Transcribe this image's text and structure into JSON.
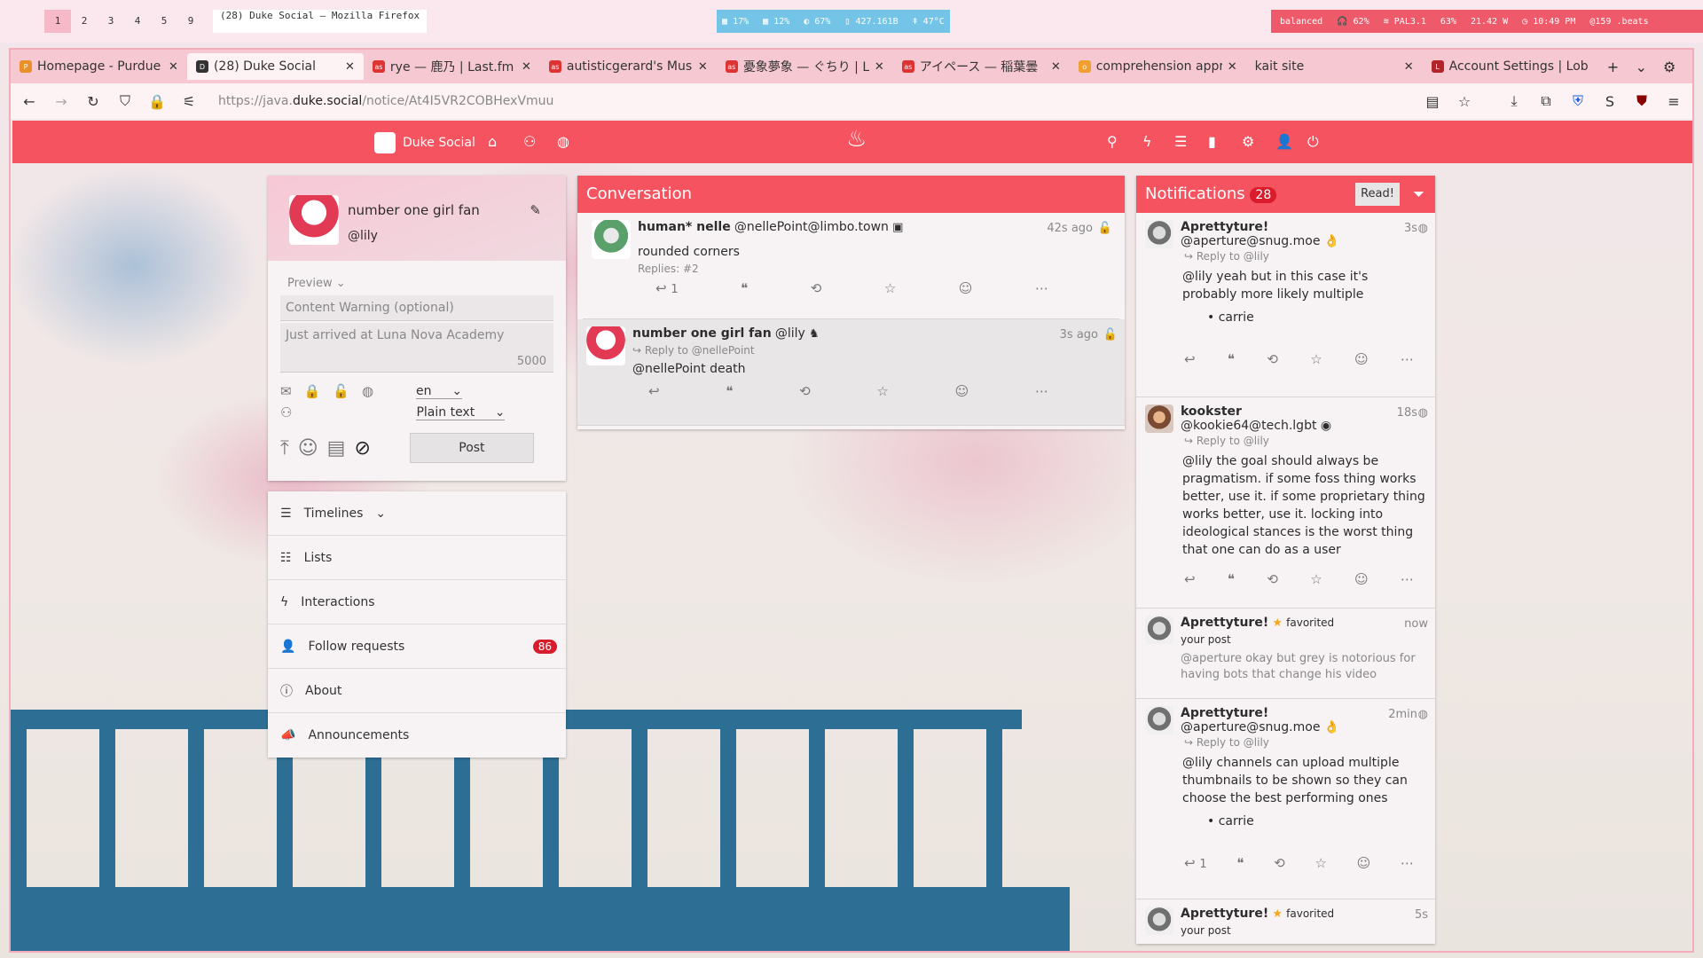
{
  "sysbar": {
    "workspaces": [
      "1",
      "2",
      "3",
      "4",
      "5",
      "9"
    ],
    "window_title": "(28) Duke Social — Mozilla Firefox",
    "stats": [
      "17%",
      "12%",
      "67%",
      "427.161B",
      "47°C"
    ],
    "right": [
      "balanced",
      "62%",
      "PAL3.1",
      "63%",
      "21.42 W",
      "10:49 PM",
      "@159 .beats"
    ]
  },
  "tabs": [
    {
      "title": "Homepage - Purdue V",
      "icon": "P"
    },
    {
      "title": "(28) Duke Social",
      "icon": "D"
    },
    {
      "title": "rye — 鹿乃 | Last.fm",
      "icon": "as"
    },
    {
      "title": "autisticgerard's Music",
      "icon": "as"
    },
    {
      "title": "憂象夢象 — ぐちり | L",
      "icon": "as"
    },
    {
      "title": "アイペース — 稲葉曇",
      "icon": "as"
    },
    {
      "title": "comprehension appre",
      "icon": "o"
    },
    {
      "title": "kait site",
      "icon": ""
    },
    {
      "title": "Account Settings | Lob",
      "icon": "L"
    }
  ],
  "url": {
    "prefix": "https://java.",
    "domain": "duke.social",
    "path": "/notice/At4I5VR2COBHexVmuu"
  },
  "app": {
    "site_name": "Duke Social",
    "user": {
      "display_name": "number one girl fan",
      "handle": "@lily"
    },
    "compose": {
      "preview_label": "Preview",
      "cw_placeholder": "Content Warning (optional)",
      "status_placeholder": "Just arrived at Luna Nova Academy",
      "char_count": "5000",
      "language": "en",
      "format": "Plain text",
      "post_label": "Post"
    },
    "menu": [
      {
        "label": "Timelines",
        "icon": "☰"
      },
      {
        "label": "Lists",
        "icon": "☷"
      },
      {
        "label": "Interactions",
        "icon": "ϟ"
      },
      {
        "label": "Follow requests",
        "icon": "👤",
        "badge": "86"
      },
      {
        "label": "About",
        "icon": "ⓘ"
      },
      {
        "label": "Announcements",
        "icon": "📣"
      }
    ],
    "conversation": {
      "title": "Conversation",
      "posts": [
        {
          "name": "human* nelle",
          "handle": "@nellePoint@limbo.town",
          "time": "42s ago",
          "body": "rounded corners",
          "replies": "Replies: #2",
          "reply_count": "1"
        },
        {
          "name": "number one girl fan",
          "handle": "@lily",
          "time": "3s ago",
          "reply_to": "Reply to @nellePoint",
          "body": "@nellePoint death"
        }
      ]
    },
    "notifications": {
      "title": "Notifications",
      "count": "28",
      "read_label": "Read!",
      "items": [
        {
          "name": "Aprettyture!",
          "handle": "@aperture@snug.moe",
          "time": "3s",
          "reply_to": "Reply to @lily",
          "body": "@lily yeah but in this case it's probably more likely multiple",
          "bullet": "carrie"
        },
        {
          "name": "kookster",
          "handle": "@kookie64@tech.lgbt",
          "time": "18s",
          "reply_to": "Reply to @lily",
          "body": "@lily the goal should always be pragmatism. if some foss thing works better, use it. if some proprietary thing works better, use it. locking into ideological stances is the worst thing that one can do as a user"
        },
        {
          "name": "Aprettyture!",
          "action": "favorited",
          "time": "now",
          "sub": "your post",
          "body": "@aperture okay but grey is notorious for having bots that change his video"
        },
        {
          "name": "Aprettyture!",
          "handle": "@aperture@snug.moe",
          "time": "2min",
          "reply_to": "Reply to @lily",
          "body": "@lily channels can upload multiple thumbnails to be shown so they can choose the best performing ones",
          "bullet": "carrie",
          "reply_count": "1"
        },
        {
          "name": "Aprettyture!",
          "action": "favorited",
          "time": "5s",
          "sub": "your post"
        }
      ]
    }
  },
  "colors": {
    "accent": "#f5535f",
    "panel": "#f7f3f4",
    "badge": "#d91b2b"
  }
}
